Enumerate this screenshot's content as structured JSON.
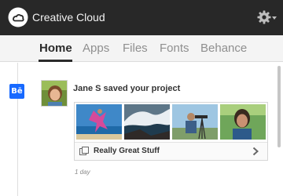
{
  "app": {
    "title": "Creative Cloud"
  },
  "icons": {
    "logo": "creative-cloud-logo-icon",
    "settings": "gear-icon",
    "settings_menu": "caret-down-icon",
    "service": "behance-icon",
    "project": "project-icon",
    "open": "chevron-right-icon"
  },
  "tabs": [
    {
      "label": "Home",
      "active": true
    },
    {
      "label": "Apps",
      "active": false
    },
    {
      "label": "Files",
      "active": false
    },
    {
      "label": "Fonts",
      "active": false
    },
    {
      "label": "Behance",
      "active": false
    }
  ],
  "feed": {
    "items": [
      {
        "service_badge": "Bē",
        "message": "Jane S saved your project",
        "project_title": "Really Great Stuff",
        "time": "1 day",
        "thumbnails": [
          "girl-jumping-beach",
          "ocean-wave-splash",
          "photographer-with-tripod",
          "smiling-woman-outdoors"
        ]
      }
    ]
  },
  "colors": {
    "titlebar": "#282828",
    "tabbar": "#f4f4f4",
    "active_tab": "#2b2b2b",
    "inactive_tab": "#8f8f8f",
    "behance_blue": "#1769ff"
  }
}
